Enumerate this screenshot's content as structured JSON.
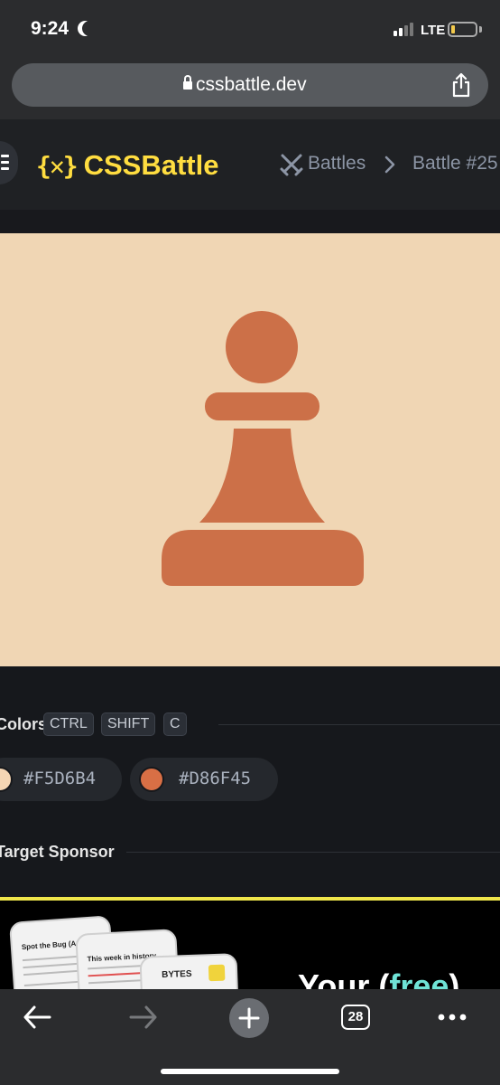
{
  "status_bar": {
    "time": "9:24",
    "network": "LTE"
  },
  "browser": {
    "url": "cssbattle.dev",
    "tab_count": "28"
  },
  "header": {
    "logo_mark": "{✕}",
    "logo_text": "CSSBattle",
    "breadcrumb": {
      "battles": "Battles",
      "battle": "Battle #25"
    }
  },
  "colors_section": {
    "label": "Colors",
    "shortcut_keys": [
      "CTRL",
      "SHIFT",
      "C"
    ],
    "swatches": [
      {
        "hex": "#F5D6B4",
        "color": "#f5d6b4"
      },
      {
        "hex": "#D86F45",
        "color": "#d86f45"
      }
    ]
  },
  "sponsor_section": {
    "label": "Target Sponsor",
    "banner": {
      "phone_titles": [
        "Spot the Bug (Answer Below)",
        "This week in history",
        "BYTES"
      ],
      "text_before": "Your (",
      "text_highlight": "free",
      "text_after": ")"
    }
  },
  "target": {
    "background": "#f0d6b4",
    "pawn_color": "#cc7048"
  }
}
